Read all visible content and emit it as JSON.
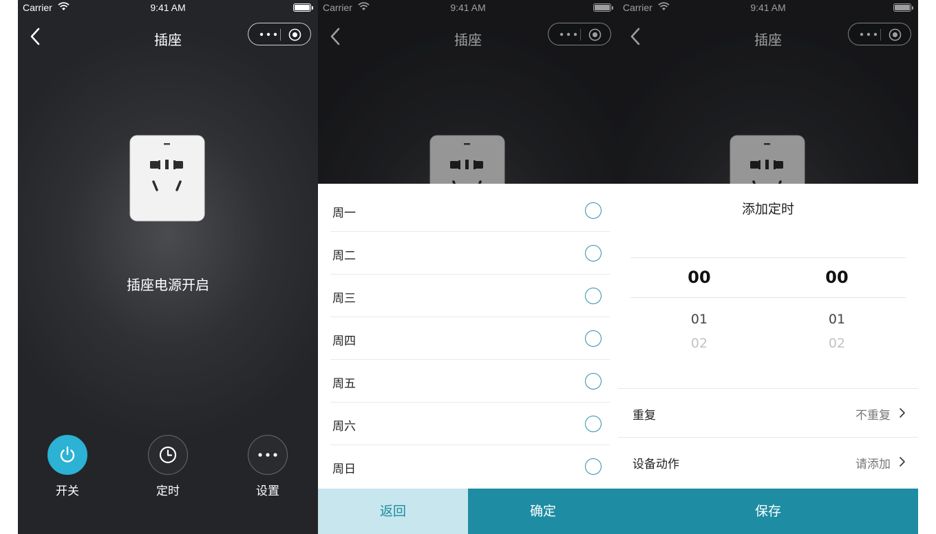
{
  "status_bar": {
    "carrier": "Carrier",
    "time": "9:41 AM"
  },
  "nav": {
    "title": "插座"
  },
  "main": {
    "status_text": "插座电源开启",
    "controls": [
      {
        "label": "开关",
        "icon": "power-icon"
      },
      {
        "label": "定时",
        "icon": "clock-icon"
      },
      {
        "label": "设置",
        "icon": "more-icon"
      }
    ]
  },
  "repeat_sheet": {
    "days": [
      "周一",
      "周二",
      "周三",
      "周四",
      "周五",
      "周六",
      "周日"
    ],
    "back_label": "返回",
    "confirm_label": "确定"
  },
  "timer_sheet": {
    "title": "添加定时",
    "hours": {
      "selected": "00",
      "next": "01",
      "next2": "02"
    },
    "minutes": {
      "selected": "00",
      "next": "01",
      "next2": "02"
    },
    "repeat": {
      "label": "重复",
      "value": "不重复"
    },
    "action": {
      "label": "设备动作",
      "value": "请添加"
    },
    "save_label": "保存"
  },
  "colors": {
    "accent": "#1e8ca3",
    "power_on": "#2bb2d4",
    "accent_light": "#c7e6ed"
  }
}
